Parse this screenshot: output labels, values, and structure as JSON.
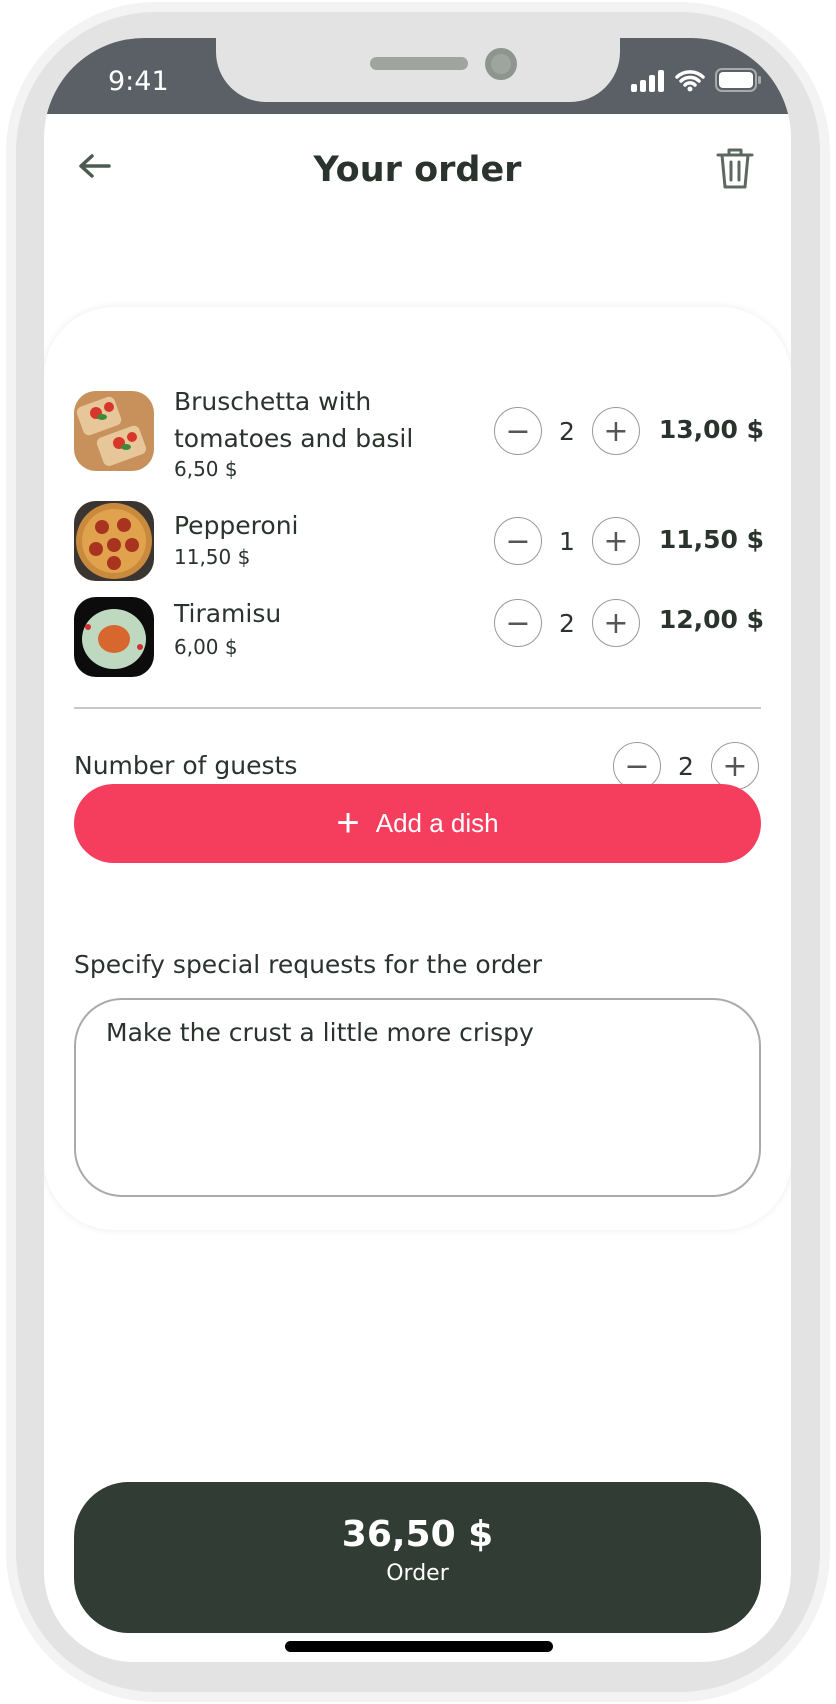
{
  "status": {
    "time": "9:41"
  },
  "header": {
    "title": "Your order"
  },
  "items": [
    {
      "name_line1": "Bruschetta with",
      "name_line2": "tomatoes and basil",
      "unit_price": "6,50 $",
      "quantity": "2",
      "total": "13,00 $"
    },
    {
      "name_line1": "Pepperoni",
      "unit_price": "11,50 $",
      "quantity": "1",
      "total": "11,50 $"
    },
    {
      "name_line1": "Tiramisu",
      "unit_price": "6,00 $",
      "quantity": "2",
      "total": "12,00 $"
    }
  ],
  "guests": {
    "label": "Number of guests",
    "value": "2"
  },
  "add_dish": {
    "icon": "+",
    "label": "Add a dish"
  },
  "requests": {
    "label": "Specify special requests for the order",
    "value": "Make the crust a little more crispy"
  },
  "order": {
    "total": "36,50 $",
    "label": "Order"
  },
  "colors": {
    "accent": "#f53e5e",
    "dark": "#303c34",
    "status_bar": "#5a6065"
  }
}
